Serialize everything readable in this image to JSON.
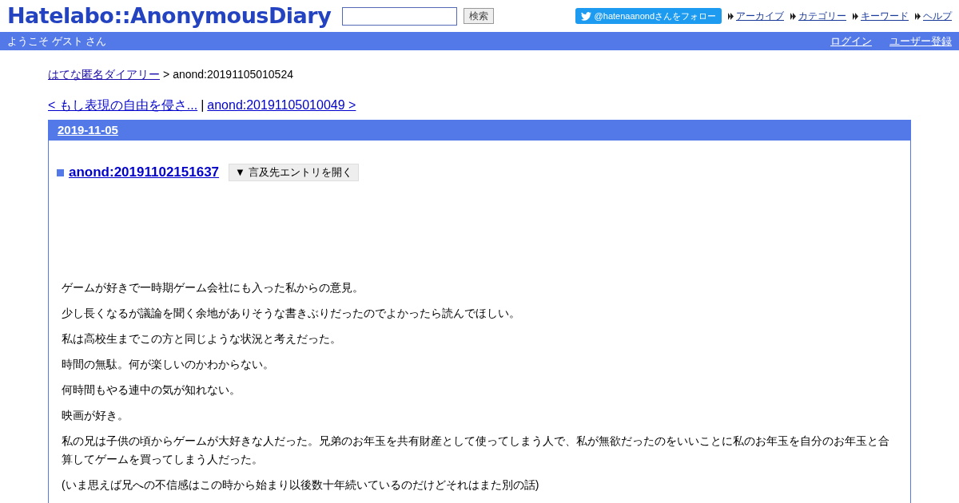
{
  "header": {
    "logo": "Hatelabo::AnonymousDiary",
    "search": {
      "button": "検索"
    },
    "follow_button": "@hatenaanondさんをフォロー",
    "nav_links": [
      "アーカイブ",
      "カテゴリー",
      "キーワード",
      "ヘルプ"
    ]
  },
  "welcome_bar": {
    "greeting": "ようこそ ゲスト さん",
    "links": [
      "ログイン",
      "ユーザー登録"
    ]
  },
  "breadcrumb": {
    "home": "はてな匿名ダイアリー",
    "separator": ">",
    "current": "anond:20191105010524"
  },
  "pager": {
    "prev": "< もし表現の自由を侵さ...",
    "separator": "|",
    "next": "anond:20191105010049 >"
  },
  "day": {
    "date": "2019-11-05",
    "entry_title": "anond:20191102151637",
    "expand_button": "▼ 言及先エントリを開く",
    "paragraphs": [
      "ゲームが好きで一時期ゲーム会社にも入った私からの意見。",
      "少し長くなるが議論を聞く余地がありそうな書きぶりだったのでよかったら読んでほしい。",
      "私は高校生までこの方と同じような状況と考えだった。",
      "時間の無駄。何が楽しいのかわからない。",
      "何時間もやる連中の気が知れない。",
      "映画が好き。",
      "私の兄は子供の頃からゲームが大好きな人だった。兄弟のお年玉を共有財産として使ってしまう人で、私が無欲だったのをいいことに私のお年玉を自分のお年玉と合算してゲームを買ってしまう人だった。",
      "(いま思えば兄への不信感はこの時から始まり以後数十年続いているのだけどそれはまた別の話)"
    ]
  }
}
